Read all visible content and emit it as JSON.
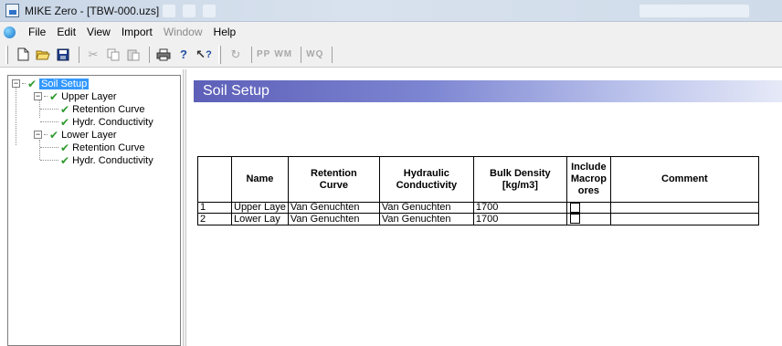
{
  "window": {
    "title": "MIKE Zero - [TBW-000.uzs]"
  },
  "menu": {
    "items": [
      {
        "label": "File",
        "disabled": false
      },
      {
        "label": "Edit",
        "disabled": false
      },
      {
        "label": "View",
        "disabled": false
      },
      {
        "label": "Import",
        "disabled": false
      },
      {
        "label": "Window",
        "disabled": true
      },
      {
        "label": "Help",
        "disabled": false
      }
    ]
  },
  "toolbar": {
    "buttons": [
      "new-icon",
      "open-icon",
      "save-icon",
      "cut-icon",
      "copy-icon",
      "paste-icon",
      "print-icon",
      "help-icon",
      "context-help-icon",
      "refresh-icon"
    ],
    "text_buttons": [
      "PP",
      "WM",
      "WQ"
    ]
  },
  "tree": {
    "nodes": [
      {
        "label": "Soil Setup",
        "selected": true,
        "level": 0,
        "expander": "−"
      },
      {
        "label": "Upper Layer",
        "level": 1,
        "expander": "−"
      },
      {
        "label": "Retention Curve",
        "level": 2
      },
      {
        "label": "Hydr. Conductivity",
        "level": 2
      },
      {
        "label": "Lower Layer",
        "level": 1,
        "expander": "−"
      },
      {
        "label": "Retention Curve",
        "level": 2
      },
      {
        "label": "Hydr. Conductivity",
        "level": 2
      }
    ]
  },
  "panel": {
    "title": "Soil Setup"
  },
  "table": {
    "headers": [
      "",
      "Name",
      "Retention\nCurve",
      "Hydraulic\nConductivity",
      "Bulk Density\n[kg/m3]",
      "Include\nMacrop\nores",
      "Comment"
    ],
    "rows": [
      {
        "index": "1",
        "name": "Upper Laye",
        "retention": "Van Genuchten",
        "conductivity": "Van Genuchten",
        "density": "1700",
        "macropores": false,
        "comment": ""
      },
      {
        "index": "2",
        "name": "Lower Lay",
        "retention": "Van Genuchten",
        "conductivity": "Van Genuchten",
        "density": "1700",
        "macropores": false,
        "comment": ""
      }
    ]
  },
  "colors": {
    "banner_start": "#5d5fb8",
    "selection": "#3399ff",
    "check": "#2e9a2e"
  }
}
